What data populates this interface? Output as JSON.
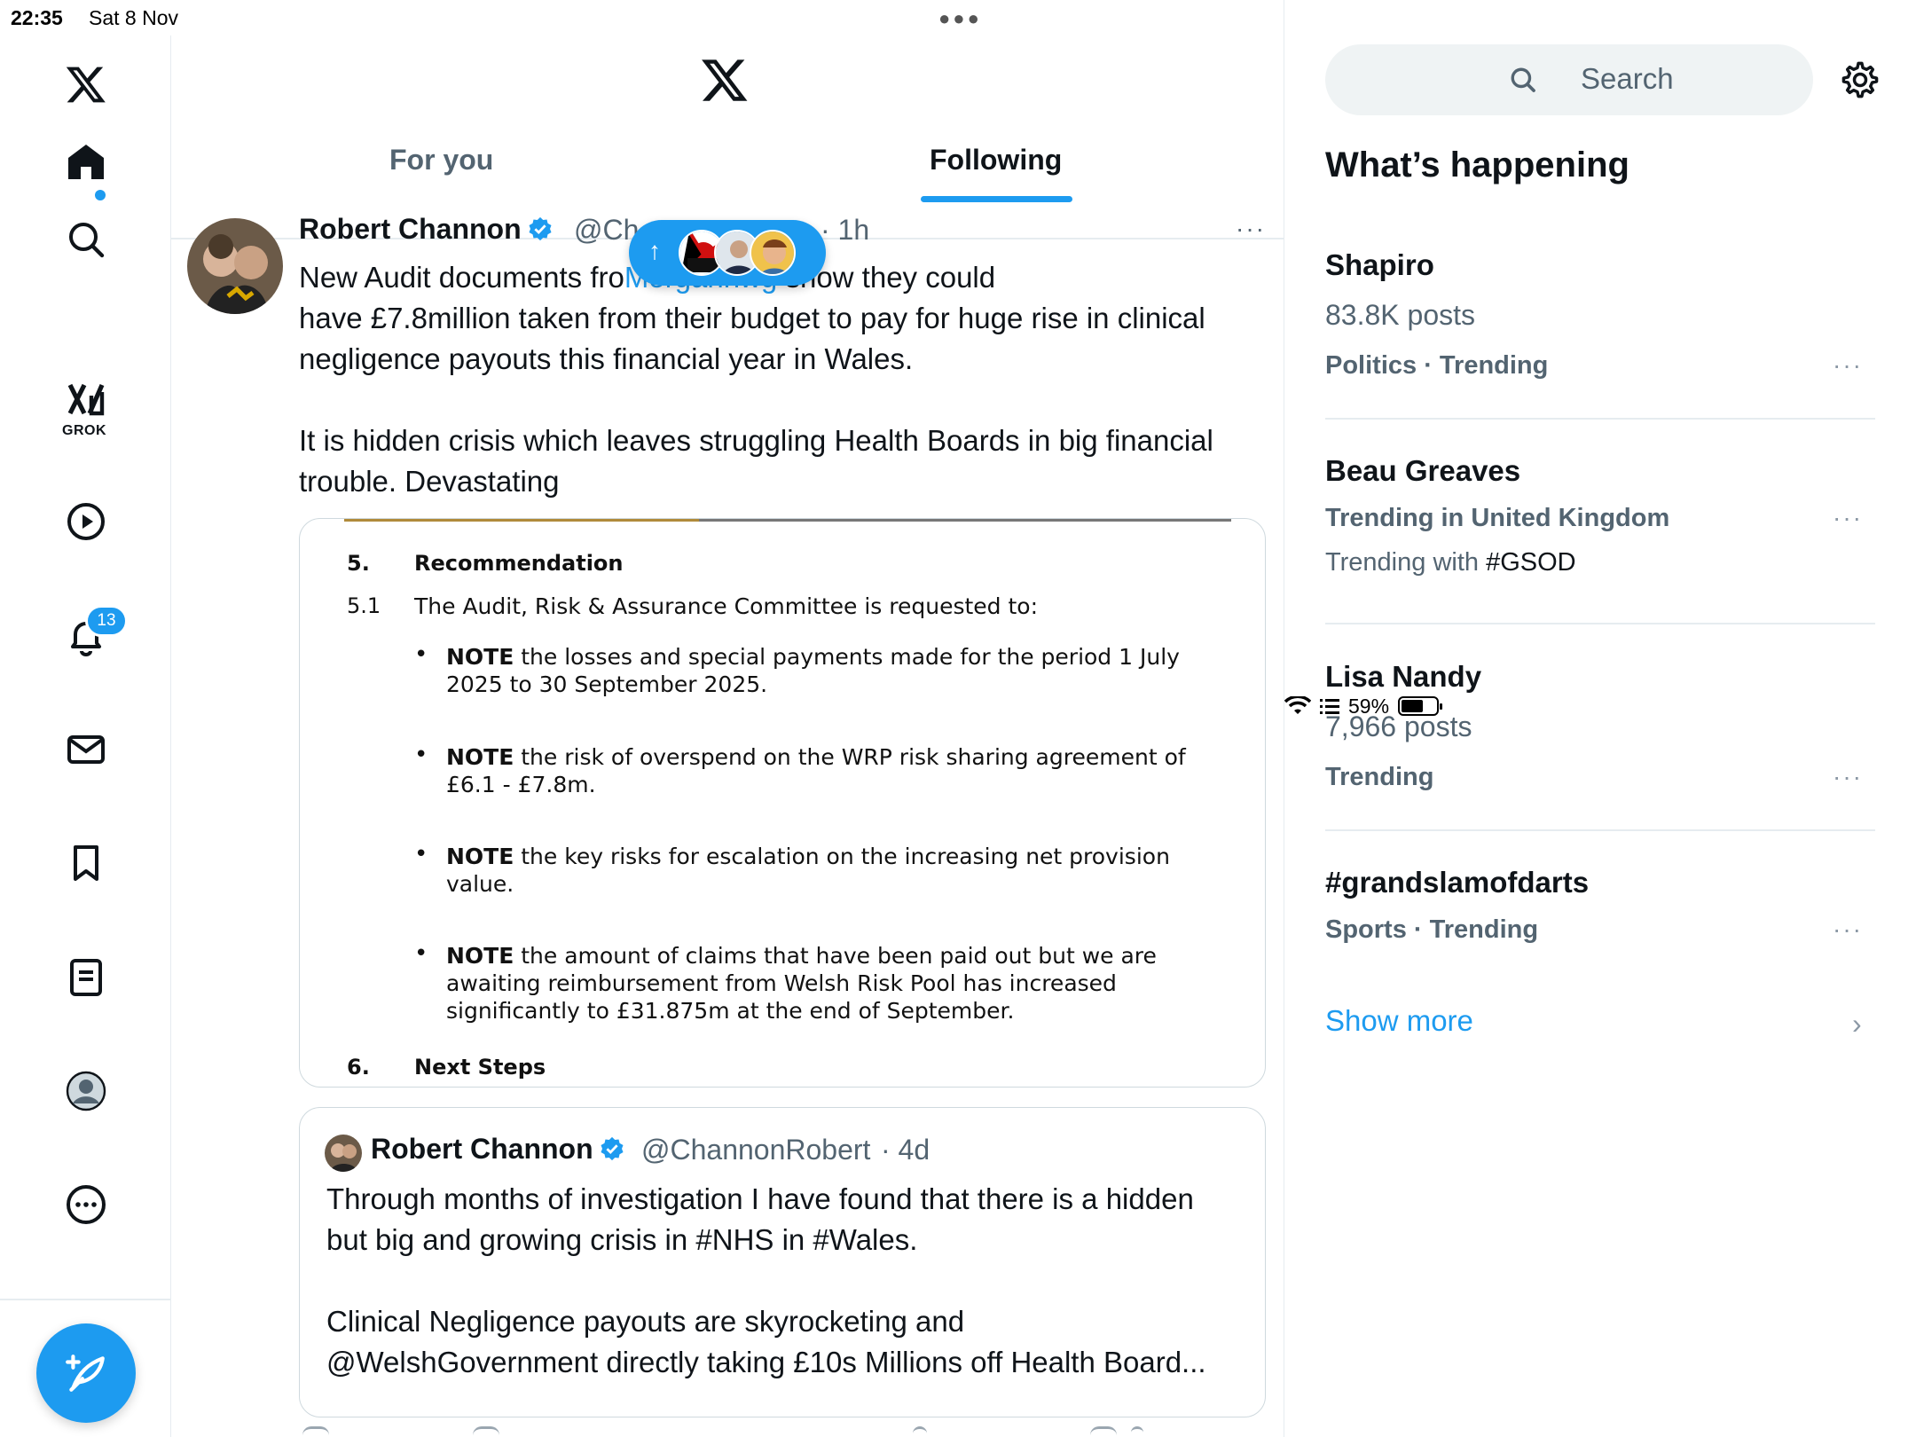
{
  "status_bar": {
    "time": "22:35",
    "date": "Sat 8 Nov",
    "battery": "59%",
    "battery_level": 0.59
  },
  "nav": {
    "grok_label": "GROK",
    "notifications_badge": "13",
    "items": [
      "x-logo-icon",
      "home-icon",
      "search-icon",
      "grok-icon",
      "video-icon",
      "bell-icon",
      "mail-icon",
      "bookmark-icon",
      "lists-icon",
      "profile-icon",
      "more-icon"
    ]
  },
  "tabs": {
    "for_you": "For you",
    "following": "Following"
  },
  "post": {
    "name": "Robert Channon",
    "handle": "@Ch",
    "time": "· 1h",
    "more": "···",
    "text_before_mention": "New Audit documents fro",
    "mention": "Morgannwg",
    "text_after_mention": " show they could\nhave £7.8million taken from their budget to pay for huge rise in clinical\nnegligence payouts this financial year in Wales.\n\nIt is hidden crisis which leaves struggling Health Boards in big financial\ntrouble. Devastating"
  },
  "document": {
    "s5_num": "5.",
    "s5_title": "Recommendation",
    "s51_num": "5.1",
    "s51_text": "The Audit, Risk & Assurance Committee is requested to:",
    "bullets": [
      {
        "bold": "NOTE",
        "text": " the losses and special payments made for the period 1 July 2025 to 30 September 2025."
      },
      {
        "bold": "NOTE",
        "text": " the risk of overspend on the WRP risk sharing agreement of £6.1 - £7.8m."
      },
      {
        "bold": "NOTE",
        "text": " the key risks for escalation on the increasing net provision value."
      },
      {
        "bold": "NOTE",
        "text": " the amount of claims that have been paid out but we are awaiting reimbursement from Welsh Risk Pool has increased significantly to £31.875m at the end of September."
      }
    ],
    "s6_num": "6.",
    "s6_title": "Next Steps"
  },
  "quote": {
    "name": "Robert Channon",
    "handle": "@ChannonRobert",
    "time": "· 4d",
    "text": "Through months of investigation I have found that there is a hidden\nbut big and growing crisis in #NHS in #Wales.\n\nClinical Negligence payouts are skyrocketing and\n@WelshGovernment directly taking £10s Millions off Health Board..."
  },
  "sidebar": {
    "search_placeholder": "Search",
    "section_title": "What’s happening",
    "trends": [
      {
        "title": "Shapiro",
        "sub": "83.8K posts",
        "meta": "Politics · Trending"
      },
      {
        "title": "Beau Greaves",
        "meta": "Trending in United Kingdom",
        "with_label": "Trending with ",
        "with_tag": "#GSOD"
      },
      {
        "title": "Lisa Nandy",
        "sub": "7,966 posts",
        "meta": "Trending"
      },
      {
        "title": "#grandslamofdarts",
        "meta": "Sports · Trending"
      }
    ],
    "more_label": "···",
    "show_more": "Show more",
    "chevron": "›"
  },
  "colors": {
    "accent": "#1d9bf0",
    "text": "#0f1419",
    "muted": "#536471",
    "border": "#e6ecf0"
  }
}
